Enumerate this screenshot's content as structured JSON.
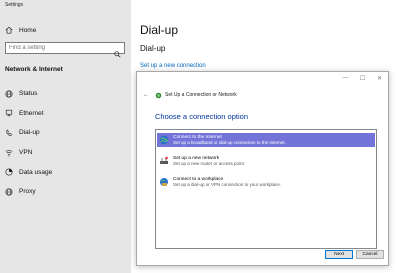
{
  "window": {
    "title": "Settings"
  },
  "sidebar": {
    "home_label": "Home",
    "search_placeholder": "Find a setting",
    "section_title": "Network & Internet",
    "items": [
      {
        "label": "Status",
        "icon": "globe-icon"
      },
      {
        "label": "Ethernet",
        "icon": "ethernet-icon"
      },
      {
        "label": "Dial-up",
        "icon": "dial-up-icon"
      },
      {
        "label": "VPN",
        "icon": "vpn-icon"
      },
      {
        "label": "Data usage",
        "icon": "data-usage-icon"
      },
      {
        "label": "Proxy",
        "icon": "globe-icon"
      }
    ]
  },
  "main": {
    "title": "Dial-up",
    "subtitle": "Dial-up",
    "link": "Set up a new connection"
  },
  "dialog": {
    "header_title": "Set Up a Connection or Network",
    "heading": "Choose a connection option",
    "options": [
      {
        "title": "Connect to the Internet",
        "desc": "Set up a broadband or dial-up connection to the Internet.",
        "selected": true
      },
      {
        "title": "Set up a new network",
        "desc": "Set up a new router or access point.",
        "selected": false
      },
      {
        "title": "Connect to a workplace",
        "desc": "Set up a dial-up or VPN connection to your workplace.",
        "selected": false
      }
    ],
    "next_label": "Next",
    "cancel_label": "Cancel"
  },
  "colors": {
    "accent": "#0067c0",
    "selection": "#7373d9",
    "heading": "#003399",
    "sidebar_bg": "#e6e6e6"
  }
}
